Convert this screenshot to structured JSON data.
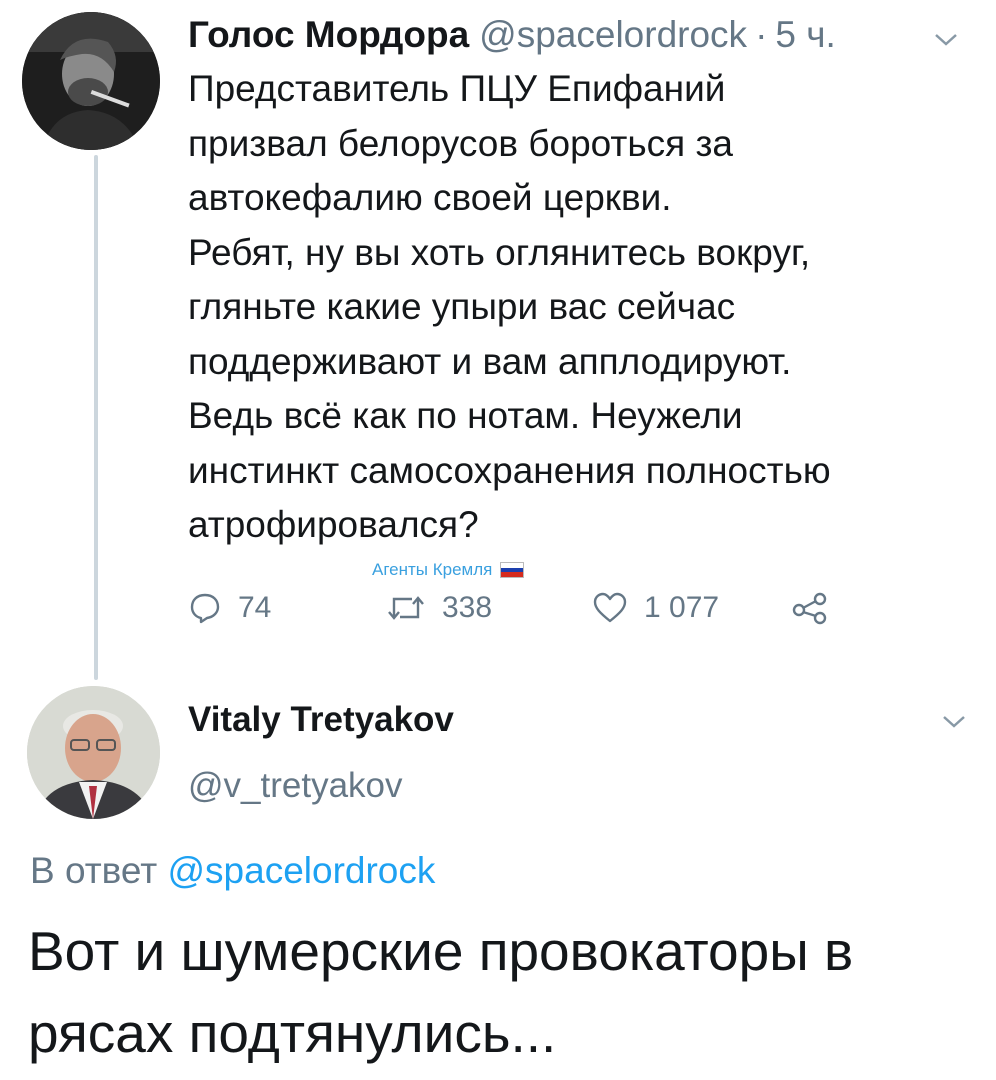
{
  "tweet1": {
    "author_name": "Голос Мордора",
    "author_handle": "@spacelordrock",
    "separator": "·",
    "time": "5 ч.",
    "avatar_icon": "avatar-photo",
    "text_lines": [
      "Представитель ПЦУ Епифаний",
      "призвал белорусов бороться за",
      "автокефалию своей церкви.",
      "Ребят, ну вы хоть оглянитесь вокруг,",
      "гляньте какие упыри вас сейчас",
      "поддерживают и вам апплодируют.",
      "Ведь всё как по нотам. Неужели",
      "инстинкт самосохранения полностью",
      "атрофировался?"
    ],
    "watermark": "Агенты Кремля",
    "actions": {
      "replies": "74",
      "retweets": "338",
      "likes": "1 077"
    }
  },
  "tweet2": {
    "author_name": "Vitaly Tretyakov",
    "author_handle": "@v_tretyakov",
    "reply_prefix": "В ответ",
    "reply_to": "@spacelordrock",
    "text_lines": [
      "Вот и шумерские провокаторы в",
      "рясах подтянулись..."
    ]
  },
  "colors": {
    "text": "#14171a",
    "secondary": "#657786",
    "link": "#1da1f2",
    "thread_line": "#ccd6dd",
    "watermark": "#3aa0df"
  }
}
